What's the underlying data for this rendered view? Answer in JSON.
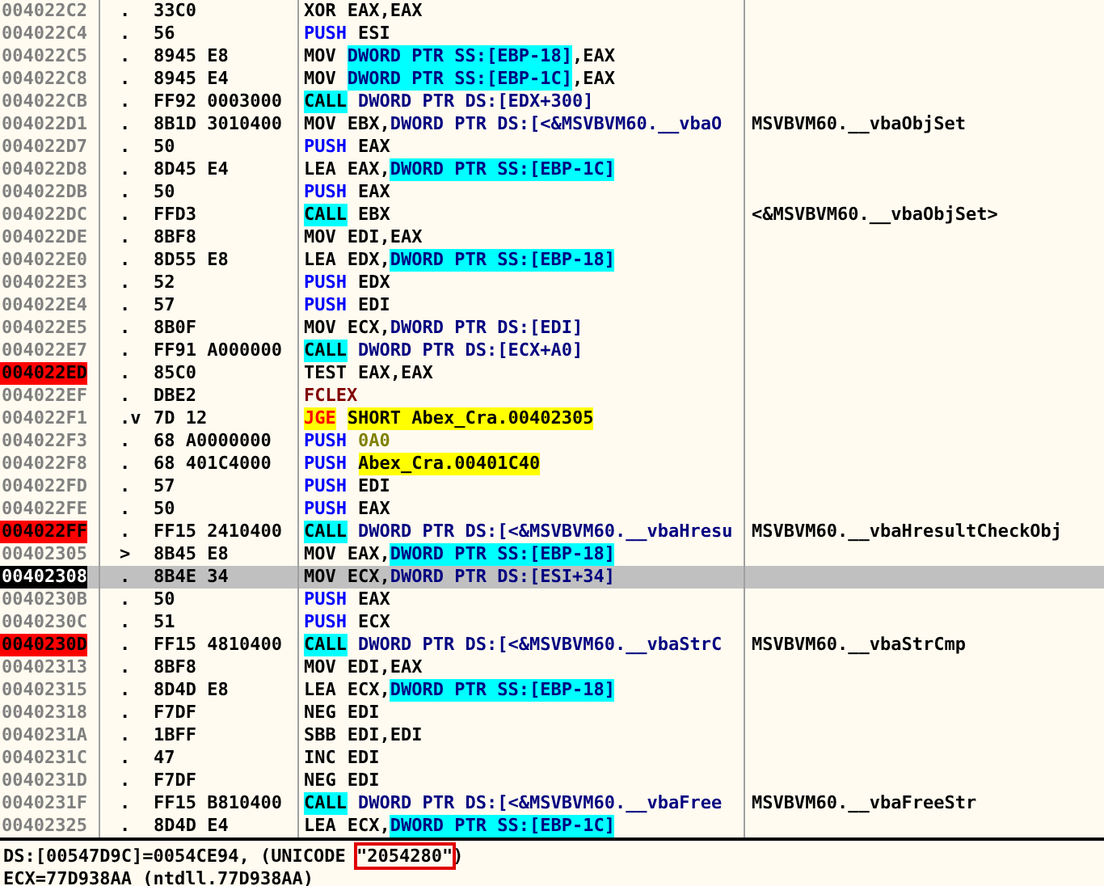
{
  "rows": [
    {
      "address": "004022C2",
      "marker": ".",
      "hex": "33C0",
      "mnemonic": "XOR",
      "kind": "plain",
      "operands": [
        {
          "kind": "reg",
          "text": "EAX,EAX"
        }
      ],
      "breakpoint": false,
      "current": false,
      "selected": false
    },
    {
      "address": "004022C4",
      "marker": ".",
      "hex": "56",
      "mnemonic": "PUSH",
      "kind": "push",
      "operands": [
        {
          "kind": "reg",
          "text": "ESI"
        }
      ],
      "breakpoint": false,
      "current": false,
      "selected": false
    },
    {
      "address": "004022C5",
      "marker": ".",
      "hex": "8945 E8",
      "mnemonic": "MOV",
      "kind": "plain",
      "operands": [
        {
          "kind": "stack",
          "text": "DWORD PTR SS:[EBP-18]"
        },
        {
          "kind": "reg",
          "text": ",EAX"
        }
      ],
      "breakpoint": false,
      "current": false,
      "selected": false
    },
    {
      "address": "004022C8",
      "marker": ".",
      "hex": "8945 E4",
      "mnemonic": "MOV",
      "kind": "plain",
      "operands": [
        {
          "kind": "stack",
          "text": "DWORD PTR SS:[EBP-1C]"
        },
        {
          "kind": "reg",
          "text": ",EAX"
        }
      ],
      "breakpoint": false,
      "current": false,
      "selected": false
    },
    {
      "address": "004022CB",
      "marker": ".",
      "hex": "FF92 0003000",
      "mnemonic": "CALL",
      "kind": "call",
      "operands": [
        {
          "kind": "mem",
          "text": "DWORD PTR DS:[EDX+300]"
        }
      ],
      "breakpoint": false,
      "current": false,
      "selected": false
    },
    {
      "address": "004022D1",
      "marker": ".",
      "hex": "8B1D 3010400",
      "mnemonic": "MOV",
      "kind": "plain",
      "operands": [
        {
          "kind": "reg",
          "text": "EBX,"
        },
        {
          "kind": "mem",
          "text": "DWORD PTR DS:[<&MSVBVM60.__vbaO"
        }
      ],
      "comment": "MSVBVM60.__vbaObjSet",
      "breakpoint": false,
      "current": false,
      "selected": false
    },
    {
      "address": "004022D7",
      "marker": ".",
      "hex": "50",
      "mnemonic": "PUSH",
      "kind": "push",
      "operands": [
        {
          "kind": "reg",
          "text": "EAX"
        }
      ],
      "breakpoint": false,
      "current": false,
      "selected": false
    },
    {
      "address": "004022D8",
      "marker": ".",
      "hex": "8D45 E4",
      "mnemonic": "LEA",
      "kind": "plain",
      "operands": [
        {
          "kind": "reg",
          "text": "EAX,"
        },
        {
          "kind": "stack",
          "text": "DWORD PTR SS:[EBP-1C]"
        }
      ],
      "breakpoint": false,
      "current": false,
      "selected": false
    },
    {
      "address": "004022DB",
      "marker": ".",
      "hex": "50",
      "mnemonic": "PUSH",
      "kind": "push",
      "operands": [
        {
          "kind": "reg",
          "text": "EAX"
        }
      ],
      "breakpoint": false,
      "current": false,
      "selected": false
    },
    {
      "address": "004022DC",
      "marker": ".",
      "hex": "FFD3",
      "mnemonic": "CALL",
      "kind": "call",
      "operands": [
        {
          "kind": "reg",
          "text": "EBX"
        }
      ],
      "comment": "<&MSVBVM60.__vbaObjSet>",
      "breakpoint": false,
      "current": false,
      "selected": false
    },
    {
      "address": "004022DE",
      "marker": ".",
      "hex": "8BF8",
      "mnemonic": "MOV",
      "kind": "plain",
      "operands": [
        {
          "kind": "reg",
          "text": "EDI,EAX"
        }
      ],
      "breakpoint": false,
      "current": false,
      "selected": false
    },
    {
      "address": "004022E0",
      "marker": ".",
      "hex": "8D55 E8",
      "mnemonic": "LEA",
      "kind": "plain",
      "operands": [
        {
          "kind": "reg",
          "text": "EDX,"
        },
        {
          "kind": "stack",
          "text": "DWORD PTR SS:[EBP-18]"
        }
      ],
      "breakpoint": false,
      "current": false,
      "selected": false
    },
    {
      "address": "004022E3",
      "marker": ".",
      "hex": "52",
      "mnemonic": "PUSH",
      "kind": "push",
      "operands": [
        {
          "kind": "reg",
          "text": "EDX"
        }
      ],
      "breakpoint": false,
      "current": false,
      "selected": false
    },
    {
      "address": "004022E4",
      "marker": ".",
      "hex": "57",
      "mnemonic": "PUSH",
      "kind": "push",
      "operands": [
        {
          "kind": "reg",
          "text": "EDI"
        }
      ],
      "breakpoint": false,
      "current": false,
      "selected": false
    },
    {
      "address": "004022E5",
      "marker": ".",
      "hex": "8B0F",
      "mnemonic": "MOV",
      "kind": "plain",
      "operands": [
        {
          "kind": "reg",
          "text": "ECX,"
        },
        {
          "kind": "mem",
          "text": "DWORD PTR DS:[EDI]"
        }
      ],
      "breakpoint": false,
      "current": false,
      "selected": false
    },
    {
      "address": "004022E7",
      "marker": ".",
      "hex": "FF91 A000000",
      "mnemonic": "CALL",
      "kind": "call",
      "operands": [
        {
          "kind": "mem",
          "text": "DWORD PTR DS:[ECX+A0]"
        }
      ],
      "breakpoint": false,
      "current": false,
      "selected": false
    },
    {
      "address": "004022ED",
      "marker": ".",
      "hex": "85C0",
      "mnemonic": "TEST",
      "kind": "plain",
      "operands": [
        {
          "kind": "reg",
          "text": "EAX,EAX"
        }
      ],
      "breakpoint": true,
      "current": false,
      "selected": false
    },
    {
      "address": "004022EF",
      "marker": ".",
      "hex": "DBE2",
      "mnemonic": "FCLEX",
      "kind": "fpu",
      "operands": [],
      "breakpoint": false,
      "current": false,
      "selected": false
    },
    {
      "address": "004022F1",
      "marker": ".v",
      "hex": "7D 12",
      "mnemonic": "JGE",
      "kind": "jump",
      "operands": [
        {
          "kind": "target",
          "text": "SHORT Abex_Cra.00402305"
        }
      ],
      "breakpoint": false,
      "current": false,
      "selected": false
    },
    {
      "address": "004022F3",
      "marker": ".",
      "hex": "68 A0000000",
      "mnemonic": "PUSH",
      "kind": "push",
      "operands": [
        {
          "kind": "const",
          "text": "0A0"
        }
      ],
      "breakpoint": false,
      "current": false,
      "selected": false
    },
    {
      "address": "004022F8",
      "marker": ".",
      "hex": "68 401C4000",
      "mnemonic": "PUSH",
      "kind": "push",
      "operands": [
        {
          "kind": "target",
          "text": "Abex_Cra.00401C40"
        }
      ],
      "breakpoint": false,
      "current": false,
      "selected": false
    },
    {
      "address": "004022FD",
      "marker": ".",
      "hex": "57",
      "mnemonic": "PUSH",
      "kind": "push",
      "operands": [
        {
          "kind": "reg",
          "text": "EDI"
        }
      ],
      "breakpoint": false,
      "current": false,
      "selected": false
    },
    {
      "address": "004022FE",
      "marker": ".",
      "hex": "50",
      "mnemonic": "PUSH",
      "kind": "push",
      "operands": [
        {
          "kind": "reg",
          "text": "EAX"
        }
      ],
      "breakpoint": false,
      "current": false,
      "selected": false
    },
    {
      "address": "004022FF",
      "marker": ".",
      "hex": "FF15 2410400",
      "mnemonic": "CALL",
      "kind": "call",
      "operands": [
        {
          "kind": "mem",
          "text": "DWORD PTR DS:[<&MSVBVM60.__vbaHresu"
        }
      ],
      "comment": "MSVBVM60.__vbaHresultCheckObj",
      "breakpoint": true,
      "current": false,
      "selected": false
    },
    {
      "address": "00402305",
      "marker": ">",
      "hex": "8B45 E8",
      "mnemonic": "MOV",
      "kind": "plain",
      "operands": [
        {
          "kind": "reg",
          "text": "EAX,"
        },
        {
          "kind": "stack",
          "text": "DWORD PTR SS:[EBP-18]"
        }
      ],
      "breakpoint": false,
      "current": false,
      "selected": false
    },
    {
      "address": "00402308",
      "marker": ".",
      "hex": "8B4E 34",
      "mnemonic": "MOV",
      "kind": "plain",
      "operands": [
        {
          "kind": "reg",
          "text": "ECX,"
        },
        {
          "kind": "mem",
          "text": "DWORD PTR DS:[ESI+34]"
        }
      ],
      "breakpoint": false,
      "current": true,
      "selected": true
    },
    {
      "address": "0040230B",
      "marker": ".",
      "hex": "50",
      "mnemonic": "PUSH",
      "kind": "push",
      "operands": [
        {
          "kind": "reg",
          "text": "EAX"
        }
      ],
      "breakpoint": false,
      "current": false,
      "selected": false
    },
    {
      "address": "0040230C",
      "marker": ".",
      "hex": "51",
      "mnemonic": "PUSH",
      "kind": "push",
      "operands": [
        {
          "kind": "reg",
          "text": "ECX"
        }
      ],
      "breakpoint": false,
      "current": false,
      "selected": false
    },
    {
      "address": "0040230D",
      "marker": ".",
      "hex": "FF15 4810400",
      "mnemonic": "CALL",
      "kind": "call",
      "operands": [
        {
          "kind": "mem",
          "text": "DWORD PTR DS:[<&MSVBVM60.__vbaStrC"
        }
      ],
      "comment": "MSVBVM60.__vbaStrCmp",
      "breakpoint": true,
      "current": false,
      "selected": false
    },
    {
      "address": "00402313",
      "marker": ".",
      "hex": "8BF8",
      "mnemonic": "MOV",
      "kind": "plain",
      "operands": [
        {
          "kind": "reg",
          "text": "EDI,EAX"
        }
      ],
      "breakpoint": false,
      "current": false,
      "selected": false
    },
    {
      "address": "00402315",
      "marker": ".",
      "hex": "8D4D E8",
      "mnemonic": "LEA",
      "kind": "plain",
      "operands": [
        {
          "kind": "reg",
          "text": "ECX,"
        },
        {
          "kind": "stack",
          "text": "DWORD PTR SS:[EBP-18]"
        }
      ],
      "breakpoint": false,
      "current": false,
      "selected": false
    },
    {
      "address": "00402318",
      "marker": ".",
      "hex": "F7DF",
      "mnemonic": "NEG",
      "kind": "plain",
      "operands": [
        {
          "kind": "reg",
          "text": "EDI"
        }
      ],
      "breakpoint": false,
      "current": false,
      "selected": false
    },
    {
      "address": "0040231A",
      "marker": ".",
      "hex": "1BFF",
      "mnemonic": "SBB",
      "kind": "plain",
      "operands": [
        {
          "kind": "reg",
          "text": "EDI,EDI"
        }
      ],
      "breakpoint": false,
      "current": false,
      "selected": false
    },
    {
      "address": "0040231C",
      "marker": ".",
      "hex": "47",
      "mnemonic": "INC",
      "kind": "plain",
      "operands": [
        {
          "kind": "reg",
          "text": "EDI"
        }
      ],
      "breakpoint": false,
      "current": false,
      "selected": false
    },
    {
      "address": "0040231D",
      "marker": ".",
      "hex": "F7DF",
      "mnemonic": "NEG",
      "kind": "plain",
      "operands": [
        {
          "kind": "reg",
          "text": "EDI"
        }
      ],
      "breakpoint": false,
      "current": false,
      "selected": false
    },
    {
      "address": "0040231F",
      "marker": ".",
      "hex": "FF15 B810400",
      "mnemonic": "CALL",
      "kind": "call",
      "operands": [
        {
          "kind": "mem",
          "text": "DWORD PTR DS:[<&MSVBVM60.__vbaFree"
        }
      ],
      "comment": "MSVBVM60.__vbaFreeStr",
      "breakpoint": false,
      "current": false,
      "selected": false
    },
    {
      "address": "00402325",
      "marker": ".",
      "hex": "8D4D E4",
      "mnemonic": "LEA",
      "kind": "plain",
      "operands": [
        {
          "kind": "reg",
          "text": "ECX,"
        },
        {
          "kind": "stack",
          "text": "DWORD PTR SS:[EBP-1C]"
        }
      ],
      "breakpoint": false,
      "current": false,
      "selected": false
    }
  ],
  "info_lines": [
    [
      {
        "kind": "plain",
        "text": "DS:[00547D9C]=0054CE94, (UNICODE "
      },
      {
        "kind": "boxed",
        "text": "\"2054280\""
      },
      {
        "kind": "plain",
        "text": ")"
      }
    ],
    [
      {
        "kind": "plain",
        "text": "ECX=77D938AA (ntdll.77D938AA)"
      }
    ]
  ]
}
